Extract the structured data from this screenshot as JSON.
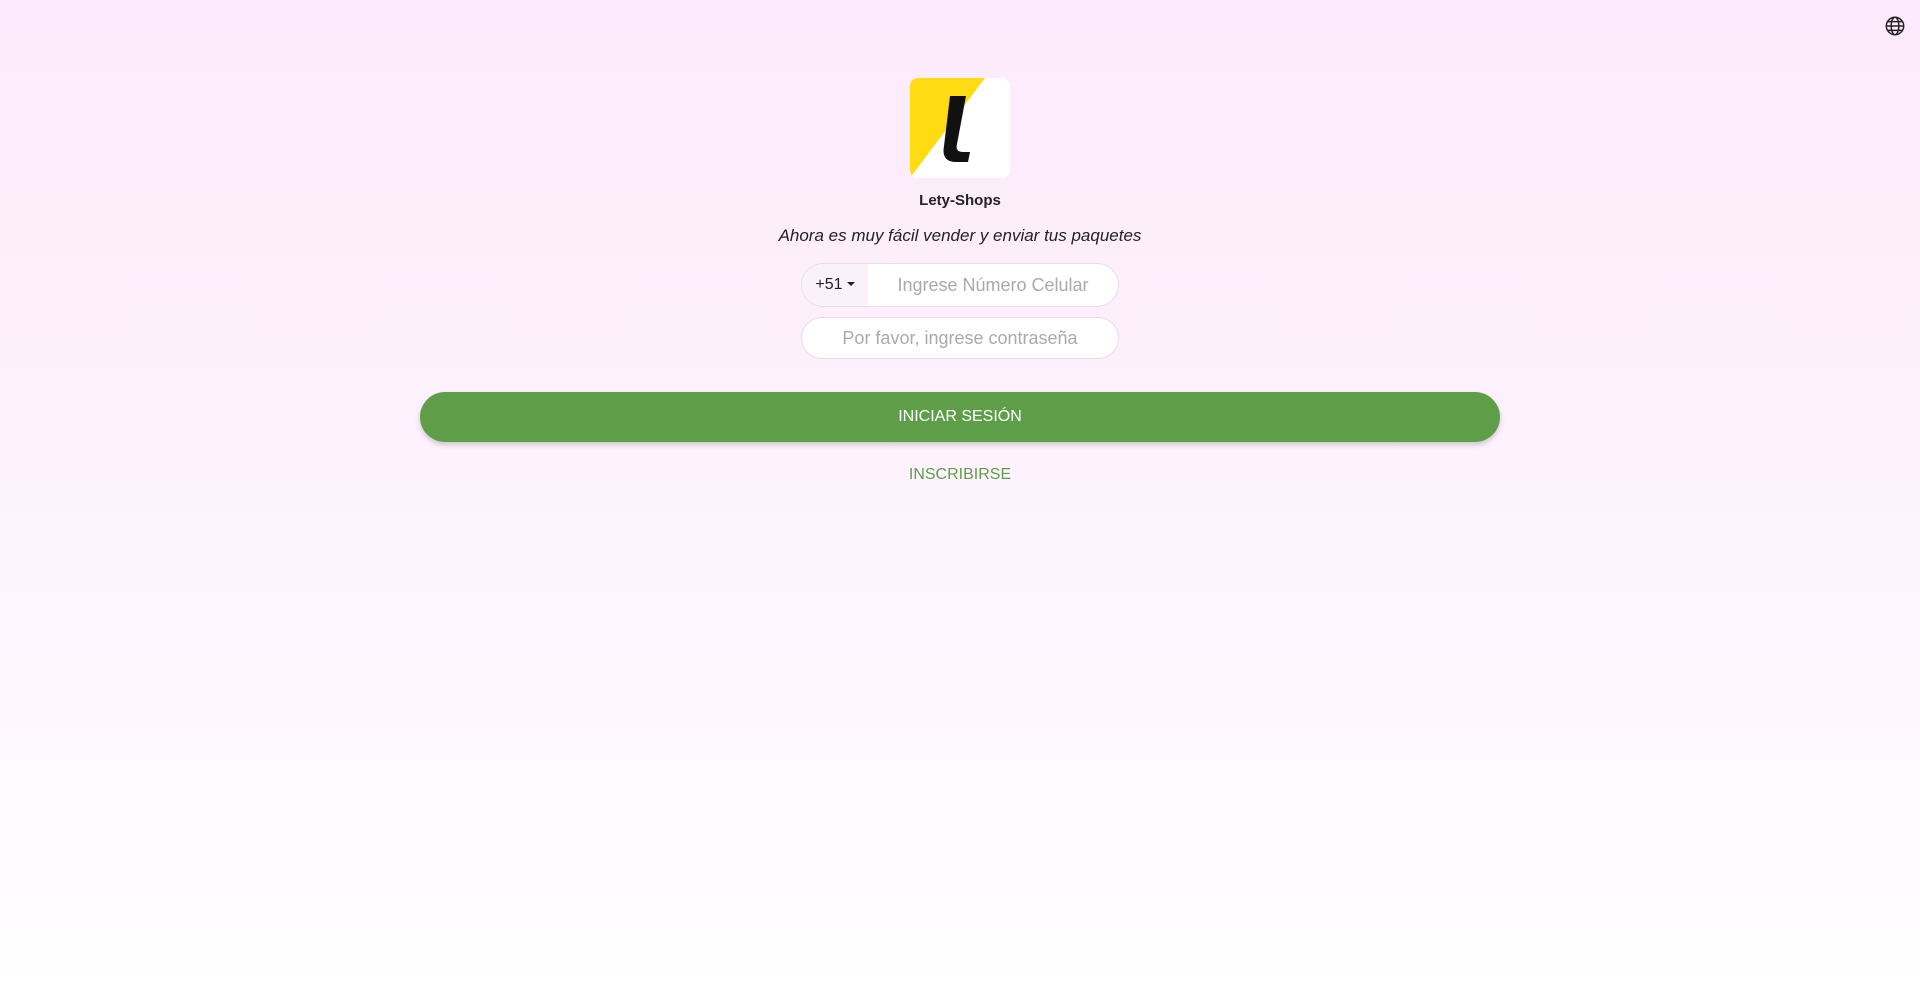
{
  "header": {
    "language_icon": "globe-icon"
  },
  "brand": {
    "name": "Lety-Shops",
    "logo_letter": "l",
    "logo_colors": {
      "yellow": "#ffdb14",
      "black": "#111111",
      "white": "#ffffff"
    }
  },
  "tagline": "Ahora es muy fácil vender y enviar tus paquetes",
  "form": {
    "country_code": "+51",
    "phone_value": "",
    "phone_placeholder": "Ingrese Número Celular",
    "password_value": "",
    "password_placeholder": "Por favor, ingrese contraseña",
    "login_label": "INICIAR SESIÓN",
    "signup_label": "INSCRIBIRSE"
  },
  "colors": {
    "accent": "#5e9e48",
    "bg_top": "#fdeafc",
    "bg_bottom": "#ffffff"
  }
}
